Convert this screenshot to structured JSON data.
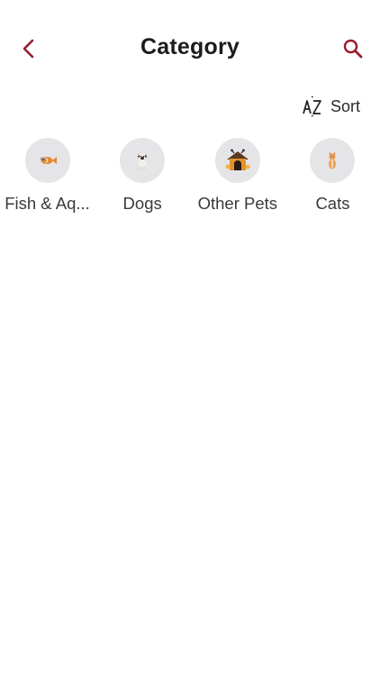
{
  "header": {
    "title": "Category",
    "back_icon": "chevron-left-icon",
    "search_icon": "search-icon",
    "accent_color": "#9b1b2a"
  },
  "sort": {
    "label": "Sort",
    "icon": "sort-az-icon"
  },
  "categories": [
    {
      "label": "Fish & Aq...",
      "icon": "fish-icon"
    },
    {
      "label": "Dogs",
      "icon": "dog-icon"
    },
    {
      "label": "Other Pets",
      "icon": "pet-house-icon"
    },
    {
      "label": "Cats",
      "icon": "cat-icon"
    }
  ]
}
